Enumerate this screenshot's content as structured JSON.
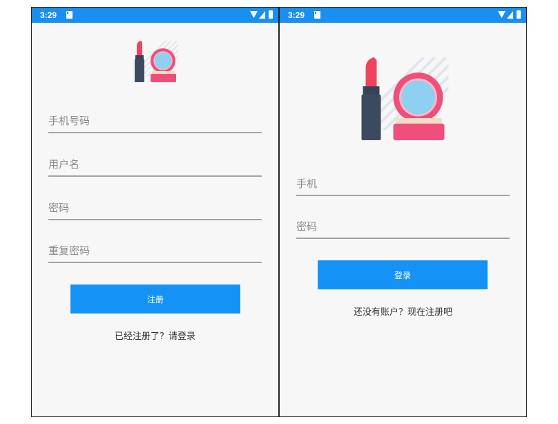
{
  "colors": {
    "status_bar": "#1a8ff2",
    "button": "#1592f5",
    "underline": "#a3a3a3",
    "background": "#f7f7f7"
  },
  "register_screen": {
    "status_bar": {
      "time": "3:29",
      "icons": [
        "sd-card-icon",
        "wifi-icon",
        "signal-icon",
        "battery-icon"
      ]
    },
    "logo": "makeup-logo-icon",
    "fields": [
      {
        "placeholder": "手机号码"
      },
      {
        "placeholder": "用户名"
      },
      {
        "placeholder": "密码"
      },
      {
        "placeholder": "重复密码"
      }
    ],
    "submit_label": "注册",
    "switch_link": "已经注册了？请登录"
  },
  "login_screen": {
    "status_bar": {
      "time": "3:29",
      "icons": [
        "sd-card-icon",
        "wifi-icon",
        "signal-icon",
        "battery-icon"
      ]
    },
    "logo": "makeup-logo-icon",
    "fields": [
      {
        "placeholder": "手机"
      },
      {
        "placeholder": "密码"
      }
    ],
    "submit_label": "登录",
    "switch_link": "还没有账户？现在注册吧"
  }
}
